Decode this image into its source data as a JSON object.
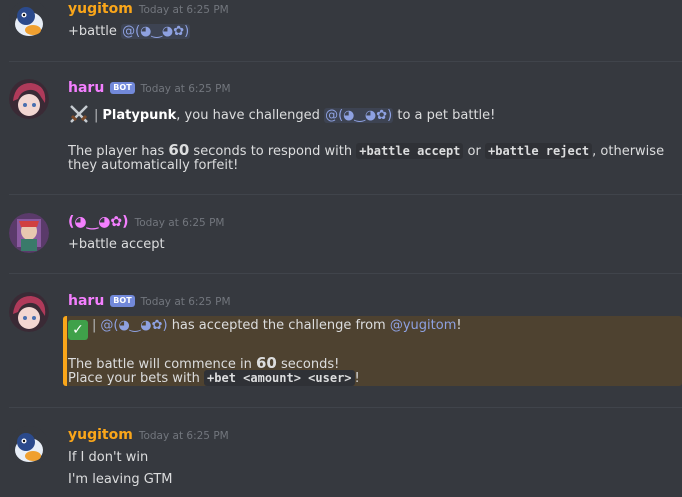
{
  "messages": [
    {
      "author": "yugitom",
      "author_color": "#faa61a",
      "timestamp": "Today at 6:25 PM",
      "lines": {
        "l1_text": "+battle ",
        "l1_mention": "@(◕‿◕✿)"
      }
    },
    {
      "author": "haru",
      "author_color": "#f47fff",
      "bot_tag": "BOT",
      "timestamp": "Today at 6:25 PM",
      "icon": "crossed-swords-icon",
      "sep": "|",
      "challenger": "Platypunk",
      "l1_after": ", you have challenged ",
      "l1_mention": "@(◕‿◕✿)",
      "l1_end": " to a pet battle!",
      "l2_a": "The player has ",
      "l2_num": "60",
      "l2_b": " seconds to respond with ",
      "l2_code1": "+battle accept",
      "l2_or": " or ",
      "l2_code2": "+battle reject",
      "l2_c": ", otherwise",
      "l3": "they automatically forfeit!"
    },
    {
      "author": "(◕‿◕✿)",
      "author_color": "#f47fff",
      "timestamp": "Today at 6:25 PM",
      "text": "+battle accept"
    },
    {
      "author": "haru",
      "author_color": "#f47fff",
      "bot_tag": "BOT",
      "timestamp": "Today at 6:25 PM",
      "embed": {
        "color": "#faa61a",
        "check_icon": "✓",
        "sep": "|",
        "mention1": "@(◕‿◕✿)",
        "accepted_text": " has accepted the challenge from ",
        "mention2": "@yugitom",
        "accepted_end": "!",
        "l2_a": "The battle will commence in ",
        "l2_num": "60",
        "l2_b": " seconds!",
        "l3_a": "Place your bets with ",
        "l3_code": "+bet <amount> <user>",
        "l3_end": "!"
      }
    },
    {
      "author": "yugitom",
      "author_color": "#faa61a",
      "timestamp": "Today at 6:25 PM",
      "line1": "If I don't win",
      "line2": "I'm leaving GTM"
    }
  ]
}
